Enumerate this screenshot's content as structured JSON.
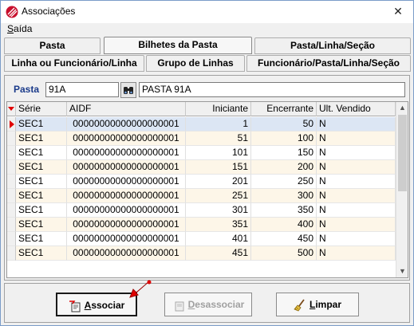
{
  "window": {
    "title": "Associações",
    "close_glyph": "✕",
    "icon": "app-logo-icon"
  },
  "menu": {
    "items": [
      {
        "label": "Saída",
        "accel": "S"
      }
    ]
  },
  "tabs": {
    "row1": [
      {
        "label": "Pasta",
        "active": false
      },
      {
        "label": "Bilhetes da Pasta",
        "active": true
      },
      {
        "label": "Pasta/Linha/Seção",
        "active": false
      }
    ],
    "row2": [
      {
        "label": "Linha ou Funcionário/Linha"
      },
      {
        "label": "Grupo de Linhas"
      },
      {
        "label": "Funcionário/Pasta/Linha/Seção"
      }
    ]
  },
  "pasta": {
    "label": "Pasta",
    "code": "91A",
    "name": "PASTA 91A",
    "search_icon": "binoculars-icon"
  },
  "grid": {
    "columns": [
      "Série",
      "AIDF",
      "Iniciante",
      "Encerrante",
      "Ult. Vendido"
    ],
    "rows": [
      [
        "SEC1",
        "00000000000000000001",
        "1",
        "50",
        "N"
      ],
      [
        "SEC1",
        "00000000000000000001",
        "51",
        "100",
        "N"
      ],
      [
        "SEC1",
        "00000000000000000001",
        "101",
        "150",
        "N"
      ],
      [
        "SEC1",
        "00000000000000000001",
        "151",
        "200",
        "N"
      ],
      [
        "SEC1",
        "00000000000000000001",
        "201",
        "250",
        "N"
      ],
      [
        "SEC1",
        "00000000000000000001",
        "251",
        "300",
        "N"
      ],
      [
        "SEC1",
        "00000000000000000001",
        "301",
        "350",
        "N"
      ],
      [
        "SEC1",
        "00000000000000000001",
        "351",
        "400",
        "N"
      ],
      [
        "SEC1",
        "00000000000000000001",
        "401",
        "450",
        "N"
      ],
      [
        "SEC1",
        "00000000000000000001",
        "451",
        "500",
        "N"
      ]
    ],
    "selected_row": 0
  },
  "buttons": {
    "associar": {
      "label": "Associar",
      "accel": "A",
      "enabled": true,
      "icon": "associate-icon"
    },
    "desassociar": {
      "label": "Desassociar",
      "accel": "D",
      "enabled": false,
      "icon": "disassociate-icon"
    },
    "limpar": {
      "label": "Limpar",
      "accel": "L",
      "enabled": true,
      "icon": "broom-icon"
    }
  },
  "colors": {
    "header_label": "#1a3a8a",
    "row_alt": "#fdf6e8",
    "row_selected": "#dce6f4",
    "indicator": "#e00000"
  }
}
